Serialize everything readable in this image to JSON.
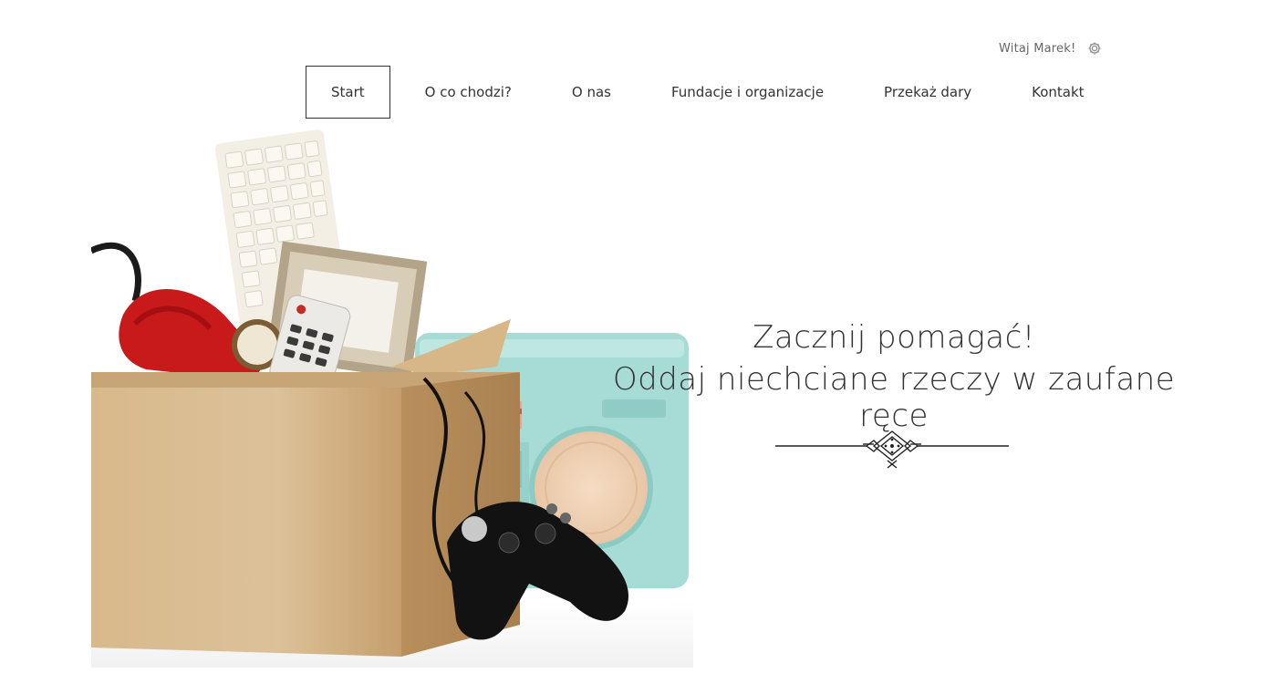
{
  "header": {
    "greeting": "Witaj Marek!",
    "settings_icon": "gear-icon"
  },
  "nav": {
    "items": [
      {
        "label": "Start",
        "active": true
      },
      {
        "label": "O co chodzi?",
        "active": false
      },
      {
        "label": "O nas",
        "active": false
      },
      {
        "label": "Fundacje i organizacje",
        "active": false
      },
      {
        "label": "Przekaż dary",
        "active": false
      },
      {
        "label": "Kontakt",
        "active": false
      }
    ]
  },
  "hero": {
    "line1": "Zacznij pomagać!",
    "line2": "Oddaj niechciane rzeczy w zaufane ręce",
    "image_subject": "donation box with keyboard, picture frame, red telephone, remote, radio and gamepad",
    "ornament_icon": "decorative-divider-icon"
  }
}
